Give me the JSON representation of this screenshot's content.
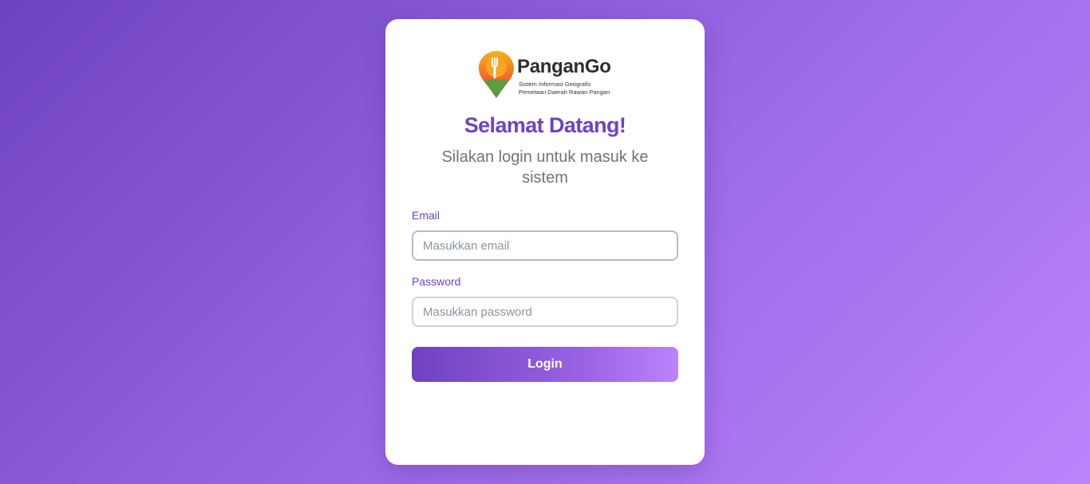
{
  "logo": {
    "brand": "PanganGo",
    "tagline_line1": "Sistem Informasi Geografis",
    "tagline_line2": "Pemetaan Daerah Rawan Pangan",
    "icon": "map-pin-fork-icon"
  },
  "heading": {
    "title": "Selamat Datang!",
    "subtitle": "Silakan login untuk masuk ke sistem"
  },
  "form": {
    "email": {
      "label": "Email",
      "placeholder": "Masukkan email",
      "value": ""
    },
    "password": {
      "label": "Password",
      "placeholder": "Masukkan password",
      "value": ""
    },
    "submit_label": "Login"
  },
  "colors": {
    "primary": "#6f42c1",
    "gradient_end": "#bb84fb",
    "subtitle": "#6c757d",
    "pin_orange": "#f08a24",
    "pin_green": "#5d9b45"
  }
}
